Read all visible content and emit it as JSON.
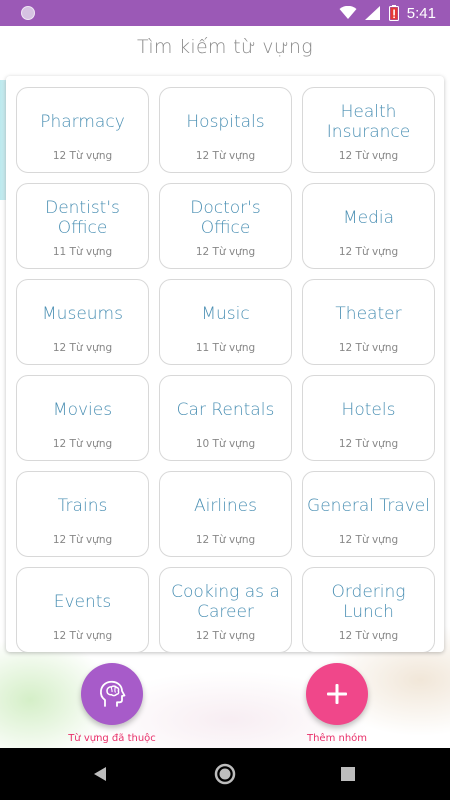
{
  "status_bar": {
    "time": "5:41"
  },
  "header": {
    "title": "Tìm kiếm từ vựng"
  },
  "cards": [
    {
      "name": "Pharmacy",
      "count": "12 Từ vựng"
    },
    {
      "name": "Hospitals",
      "count": "12 Từ vựng"
    },
    {
      "name": "Health Insurance",
      "count": "12 Từ vựng"
    },
    {
      "name": "Dentist's Office",
      "count": "11 Từ vựng"
    },
    {
      "name": "Doctor's Office",
      "count": "12 Từ vựng"
    },
    {
      "name": "Media",
      "count": "12 Từ vựng"
    },
    {
      "name": "Museums",
      "count": "12 Từ vựng"
    },
    {
      "name": "Music",
      "count": "11 Từ vựng"
    },
    {
      "name": "Theater",
      "count": "12 Từ vựng"
    },
    {
      "name": "Movies",
      "count": "12 Từ vựng"
    },
    {
      "name": "Car Rentals",
      "count": "10 Từ vựng"
    },
    {
      "name": "Hotels",
      "count": "12 Từ vựng"
    },
    {
      "name": "Trains",
      "count": "12 Từ vựng"
    },
    {
      "name": "Airlines",
      "count": "12 Từ vựng"
    },
    {
      "name": "General Travel",
      "count": "12 Từ vựng"
    },
    {
      "name": "Events",
      "count": "12 Từ vựng"
    },
    {
      "name": "Cooking as a Career",
      "count": "12 Từ vựng"
    },
    {
      "name": "Ordering Lunch",
      "count": "12 Từ vựng"
    }
  ],
  "actions": {
    "learned_label": "Từ vựng đã thuộc",
    "learned_icon": "head-brain-icon",
    "add_label": "Thêm nhóm",
    "add_icon": "plus-icon"
  },
  "colors": {
    "status_bar": "#9b59b6",
    "card_text": "#4a8fb3",
    "fab_learned": "#a75bc9",
    "fab_add": "#f0478a",
    "fab_label": "#e8306a"
  }
}
